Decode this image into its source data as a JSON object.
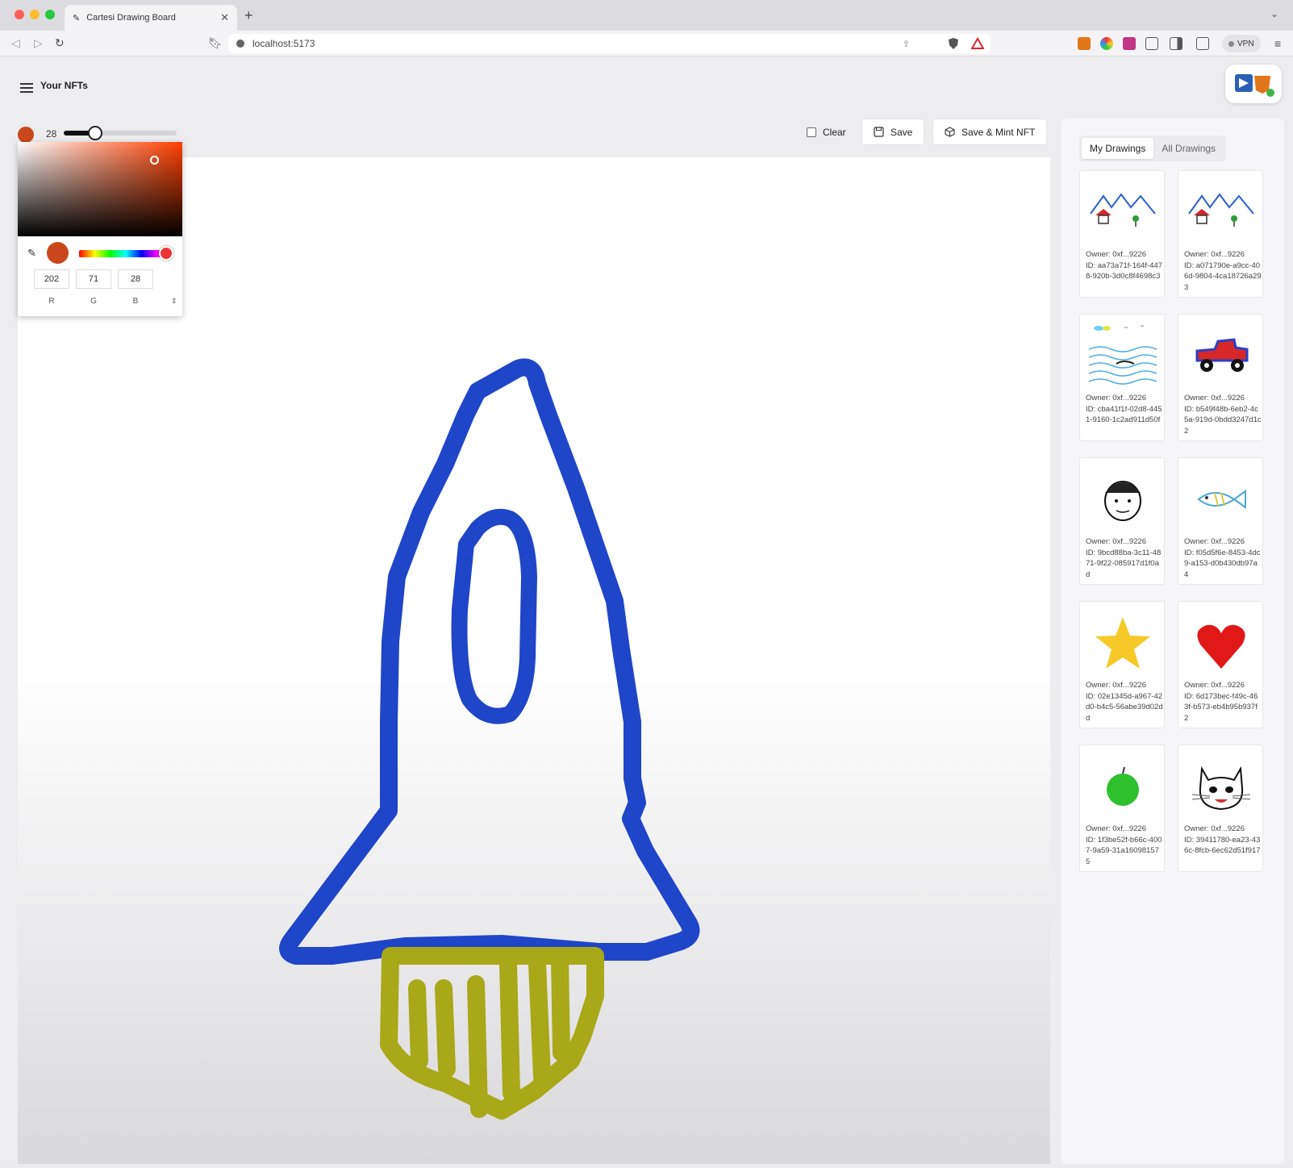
{
  "browser": {
    "tab_title": "Cartesi Drawing Board",
    "url": "localhost:5173",
    "vpn_label": "VPN"
  },
  "app": {
    "menu_title": "Your NFTs"
  },
  "toolbar": {
    "brush_size": "28",
    "brush_size_fraction": 0.28,
    "brush_color": "#ca471c",
    "clear_label": "Clear",
    "save_label": "Save",
    "mint_label": "Save & Mint NFT"
  },
  "color_picker": {
    "r": "202",
    "g": "71",
    "b": "28",
    "r_label": "R",
    "g_label": "G",
    "b_label": "B"
  },
  "sidebar": {
    "tabs": [
      "My Drawings",
      "All Drawings"
    ],
    "active_tab": "My Drawings",
    "cards": [
      {
        "owner": "Owner: 0xf...9226",
        "id": "ID: aa73a71f-164f-4478-920b-3d0c8f4698c3",
        "thumb": "mountains-house"
      },
      {
        "owner": "Owner: 0xf...9226",
        "id": "ID: a071790e-a9cc-406d-9804-4ca18726a293",
        "thumb": "mountains-house"
      },
      {
        "owner": "Owner: 0xf...9226",
        "id": "ID: cba41f1f-02d8-4451-9160-1c2ad911d50f",
        "thumb": "sea"
      },
      {
        "owner": "Owner: 0xf...9226",
        "id": "ID: b549f48b-6eb2-4c5a-919d-0bdd3247d1c2",
        "thumb": "truck"
      },
      {
        "owner": "Owner: 0xf...9226",
        "id": "ID: 9bcd88ba-3c11-4871-9f22-085917d1f0ad",
        "thumb": "face"
      },
      {
        "owner": "Owner: 0xf...9226",
        "id": "ID: f05d5f6e-8453-4dc9-a153-d0b430db97a4",
        "thumb": "fish"
      },
      {
        "owner": "Owner: 0xf...9226",
        "id": "ID: 02e1345d-a967-42d0-b4c5-56abe39d02dd",
        "thumb": "star"
      },
      {
        "owner": "Owner: 0xf...9226",
        "id": "ID: 6d173bec-f49c-463f-b573-eb4b95b937f2",
        "thumb": "heart"
      },
      {
        "owner": "Owner: 0xf...9226",
        "id": "ID: 1f3be52f-b66c-4007-9a59-31a160981575",
        "thumb": "apple"
      },
      {
        "owner": "Owner: 0xf...9226",
        "id": "ID: 39411780-ea23-436c-8fcb-6ec62d51f917",
        "thumb": "cat"
      }
    ]
  }
}
